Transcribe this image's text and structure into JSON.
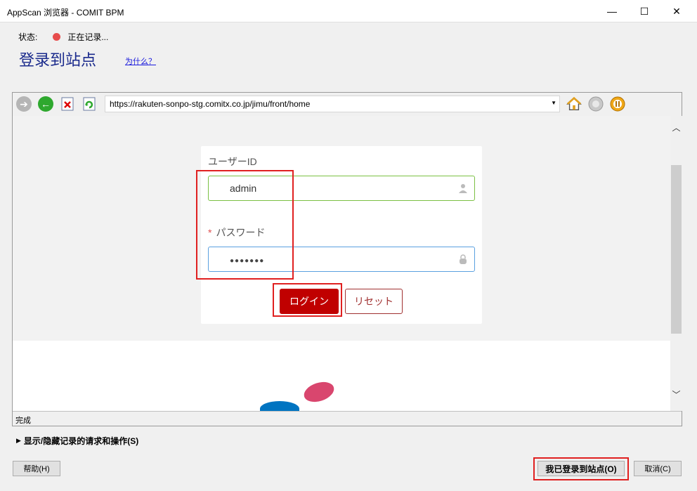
{
  "window": {
    "title": "AppScan 浏览器 - COMIT BPM",
    "minimize": "—",
    "maximize": "☐",
    "close": "✕"
  },
  "status": {
    "label": "状态:",
    "value": "正在记录..."
  },
  "page": {
    "title": "登录到站点",
    "why_link": "为什么？"
  },
  "browser": {
    "url": "https://rakuten-sonpo-stg.comitx.co.jp/jimu/front/home",
    "status_text": "完成"
  },
  "login_form": {
    "user_id_label": "ユーザーID",
    "user_id_value": "admin",
    "required_mark": "*",
    "password_label": "パスワード",
    "password_value": "●●●●●●●",
    "login_button": "ログイン",
    "reset_button": "リセット"
  },
  "bottom": {
    "toggle_label": "显示/隐藏记录的请求和操作(S)",
    "help_button": "帮助(H)",
    "logged_in_button": "我已登录到站点(O)",
    "cancel_button": "取消(C)"
  },
  "colors": {
    "title_blue": "#1a2a8c",
    "login_red": "#c00000",
    "highlight_red": "#e02020",
    "recording_dot": "#e74c4c"
  }
}
